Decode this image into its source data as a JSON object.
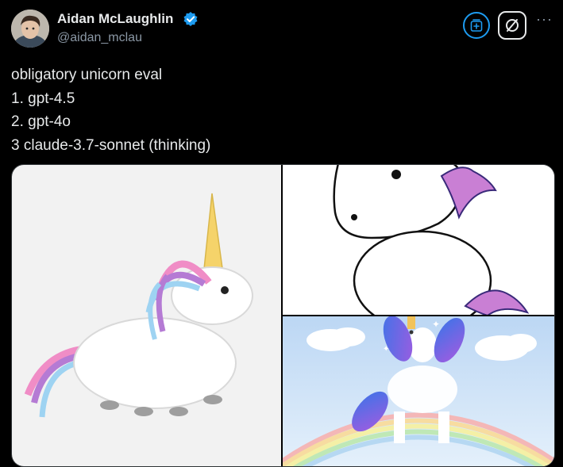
{
  "author": {
    "name": "Aidan McLaughlin",
    "handle": "@aidan_mclau",
    "verified": true
  },
  "actions": {
    "grok_icon": "grok-save-icon",
    "translate_icon": "no-translate-icon",
    "more_icon": "more-icon",
    "more_label": "···"
  },
  "tweet": {
    "lines": [
      "obligatory unicorn eval",
      "1. gpt-4.5",
      "2. gpt-4o",
      "3 claude-3.7-sonnet (thinking)"
    ]
  },
  "colors": {
    "background": "#000000",
    "text": "#e7e9ea",
    "secondary": "#8b98a5",
    "accent": "#1d9bf0"
  }
}
